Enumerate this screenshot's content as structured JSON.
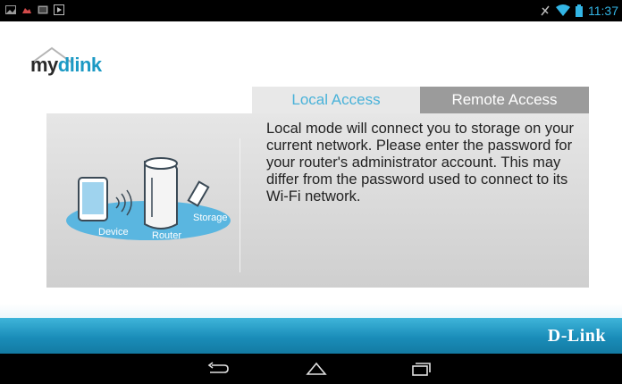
{
  "status_bar": {
    "time": "11:37",
    "left_icons": [
      "image-icon",
      "cloud-icon",
      "photo-icon",
      "media-icon"
    ],
    "right_icons": [
      "signal-icon",
      "wifi-icon",
      "battery-icon"
    ]
  },
  "logo": {
    "part1": "my",
    "part2": "dlink"
  },
  "tabs": [
    {
      "label": "Local Access",
      "selected": true
    },
    {
      "label": "Remote Access",
      "selected": false
    }
  ],
  "panel": {
    "description": "Local mode will connect you to storage on your current network. Please enter the password for your router's administrator account. This may differ from the password used to connect to its Wi-Fi network."
  },
  "illustration": {
    "device_label": "Device",
    "router_label": "Router",
    "storage_label": "Storage"
  },
  "footer": {
    "brand": "D-Link"
  },
  "nav": [
    "back-icon",
    "home-icon",
    "recent-apps-icon"
  ],
  "colors": {
    "accent": "#33b5e5",
    "tab_selected_text": "#49b2d9",
    "tab_unselected_bg": "#9b9b9b",
    "brand_band": "#1a8db9"
  }
}
